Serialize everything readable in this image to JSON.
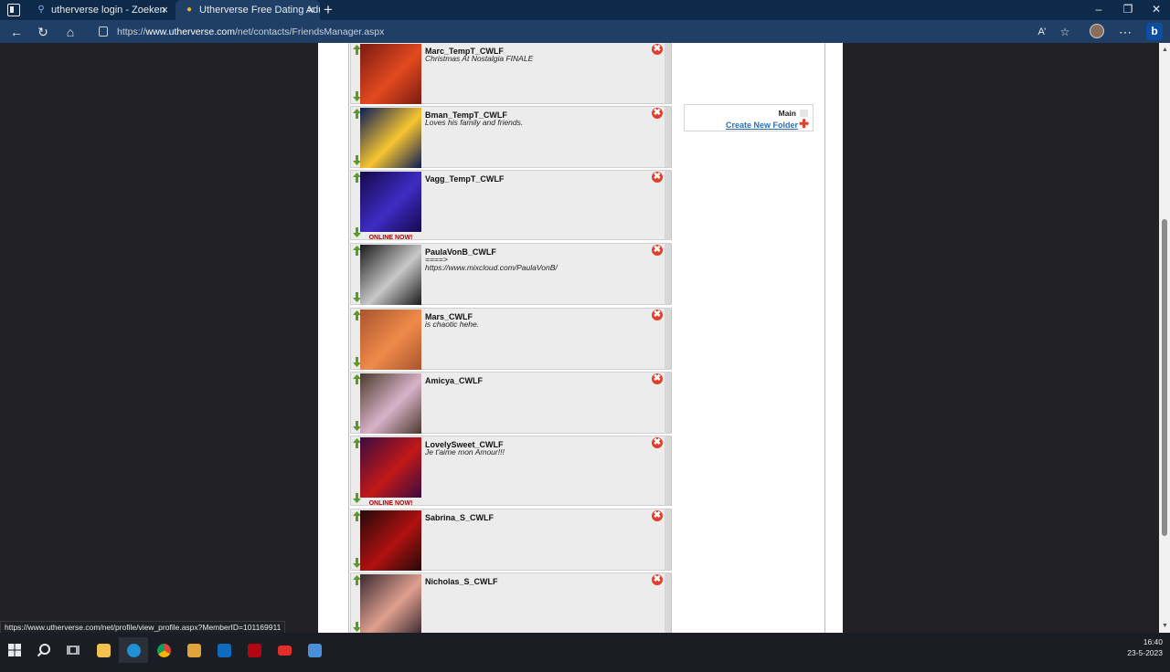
{
  "browser": {
    "tabs": [
      {
        "title": "utherverse login - Zoeken",
        "icon": "search-icon"
      },
      {
        "title": "Utherverse Free Dating Adult So",
        "icon": "utherverse-icon"
      }
    ],
    "new_tab": "+",
    "url_prefix": "https://",
    "url_host": "www.utherverse.com",
    "url_path": "/net/contacts/FriendsManager.aspx",
    "status_link": "https://www.utherverse.com/net/profile/view_profile.aspx?MemberID=101169911"
  },
  "friends": [
    {
      "name": "Marc_TempT_CWLF",
      "status": "Christmas At Nostalgia FINALE",
      "online": "",
      "thumb_color": "#7a1a12",
      "thumb_accent": "#e24a1f"
    },
    {
      "name": "Bman_TempT_CWLF",
      "status": "Loves his family and friends.",
      "online": "",
      "thumb_color": "#0b1c55",
      "thumb_accent": "#f7c531"
    },
    {
      "name": "Vagg_TempT_CWLF",
      "status": "",
      "online": "ONLINE NOW!",
      "thumb_color": "#16084a",
      "thumb_accent": "#3e2cc4"
    },
    {
      "name": "PaulaVonB_CWLF",
      "status": "====>\nhttps://www.mixcloud.com/PaulaVonB/",
      "online": "",
      "thumb_color": "#1a1a1a",
      "thumb_accent": "#c8c8c8"
    },
    {
      "name": "Mars_CWLF",
      "status": "is chaotic hehe.",
      "online": "",
      "thumb_color": "#a8542c",
      "thumb_accent": "#f08a4b"
    },
    {
      "name": "Amicya_CWLF",
      "status": "",
      "online": "",
      "thumb_color": "#4a3a2c",
      "thumb_accent": "#d9b3c9"
    },
    {
      "name": "LovelySweet_CWLF",
      "status": "Je t'aime mon Amour!!!",
      "online": "ONLINE NOW!",
      "thumb_color": "#3a0d3f",
      "thumb_accent": "#c21818"
    },
    {
      "name": "Sabrina_S_CWLF",
      "status": "",
      "online": "",
      "thumb_color": "#240a0a",
      "thumb_accent": "#b01111"
    },
    {
      "name": "Nicholas_S_CWLF",
      "status": "",
      "online": "",
      "thumb_color": "#3a2a30",
      "thumb_accent": "#e0a090"
    }
  ],
  "folders": {
    "main_label": "Main",
    "create_label": "Create New Folder"
  },
  "taskbar": {
    "time": "16:40",
    "date": "23-5-2023"
  }
}
